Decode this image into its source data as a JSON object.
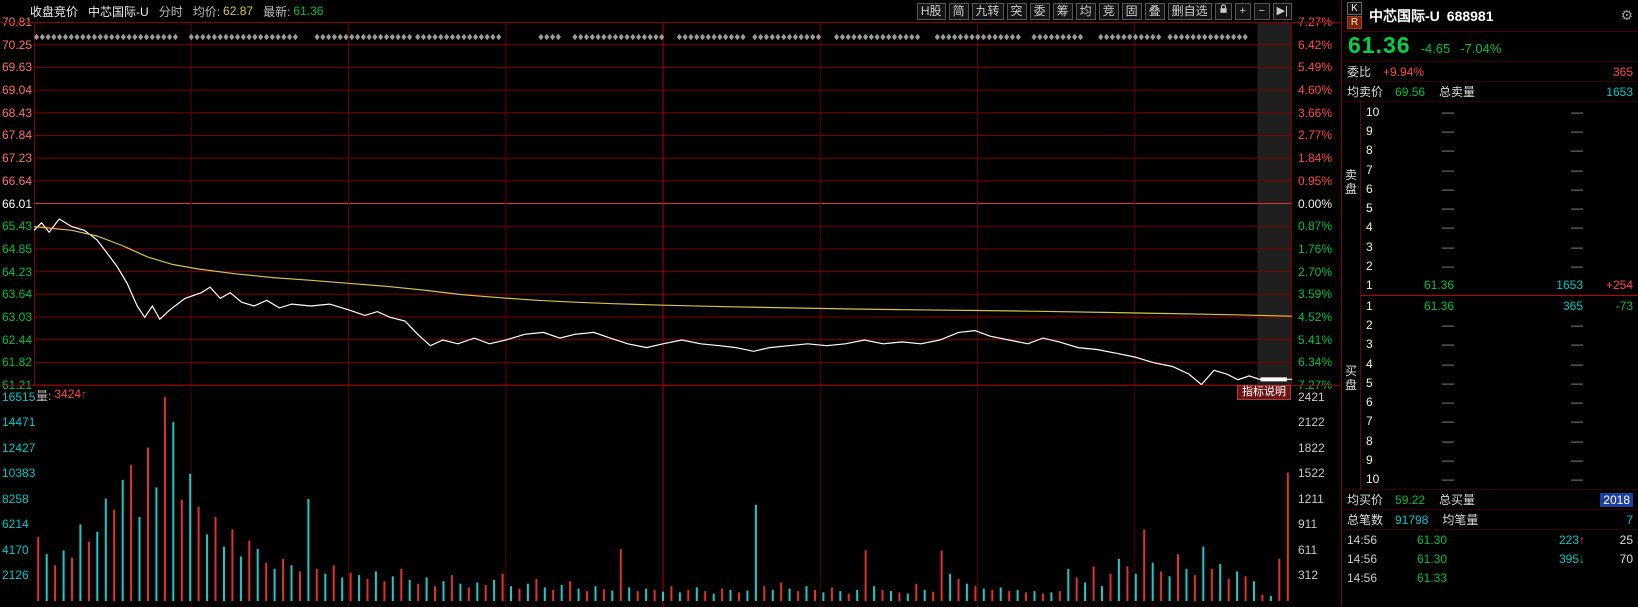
{
  "top_bar": {
    "mode_label": "收盘竞价",
    "stock_label": "中芯国际-U",
    "view_label": "分时",
    "avg_label": "均价:",
    "avg_value": "62.87",
    "last_label": "最新:",
    "last_value": "61.36",
    "buttons": [
      "H股",
      "简",
      "九转",
      "突",
      "委",
      "筹",
      "均",
      "竞",
      "固",
      "叠",
      "删自选"
    ],
    "icon_buttons": [
      "lock",
      "plus",
      "minus",
      "next"
    ]
  },
  "axes": {
    "price_left": [
      "70.81",
      "70.25",
      "69.63",
      "69.04",
      "68.43",
      "67.84",
      "67.23",
      "66.64",
      "66.01",
      "65.43",
      "64.85",
      "64.23",
      "63.64",
      "63.03",
      "62.44",
      "61.82",
      "61.21"
    ],
    "pct_right": [
      "7.27%",
      "6.42%",
      "5.49%",
      "4.60%",
      "3.66%",
      "2.77%",
      "1.84%",
      "0.95%",
      "0.00%",
      "0.87%",
      "1.76%",
      "2.70%",
      "3.59%",
      "4.52%",
      "5.41%",
      "6.34%",
      "7.27%"
    ],
    "vol_left": [
      "16515",
      "14471",
      "12427",
      "10383",
      "8258",
      "6214",
      "4170",
      "2126"
    ],
    "vol_right": [
      "2421",
      "2122",
      "1822",
      "1522",
      "1211",
      "911",
      "611",
      "312"
    ]
  },
  "volume_header": {
    "label": "量:",
    "value": "3424",
    "arrow": "↑",
    "right_button": "指标说明"
  },
  "chart_data": {
    "type": "line",
    "title": "中芯国际-U 分时",
    "prev_close": 66.01,
    "price_range": [
      61.21,
      70.81
    ],
    "x_axis": "time 09:30-15:00 (normalized 0-1, closing auction zone at right)",
    "vgrid": [
      0.125,
      0.25,
      0.375,
      0.5,
      0.625,
      0.75,
      0.875
    ],
    "auction_zone": [
      0.9725,
      1.0
    ],
    "diamond_clusters": [
      [
        0.002,
        0.115
      ],
      [
        0.125,
        0.21
      ],
      [
        0.225,
        0.3
      ],
      [
        0.305,
        0.37
      ],
      [
        0.403,
        0.418
      ],
      [
        0.43,
        0.5
      ],
      [
        0.513,
        0.565
      ],
      [
        0.573,
        0.625
      ],
      [
        0.638,
        0.705
      ],
      [
        0.718,
        0.785
      ],
      [
        0.795,
        0.835
      ],
      [
        0.848,
        0.895
      ],
      [
        0.903,
        0.965
      ]
    ],
    "series": [
      {
        "name": "price",
        "color": "#ffffff",
        "points": [
          [
            0,
            65.3
          ],
          [
            0.006,
            65.5
          ],
          [
            0.012,
            65.25
          ],
          [
            0.02,
            65.6
          ],
          [
            0.03,
            65.4
          ],
          [
            0.04,
            65.3
          ],
          [
            0.05,
            65.05
          ],
          [
            0.058,
            64.7
          ],
          [
            0.066,
            64.35
          ],
          [
            0.074,
            63.9
          ],
          [
            0.082,
            63.3
          ],
          [
            0.088,
            63.0
          ],
          [
            0.094,
            63.3
          ],
          [
            0.1,
            62.95
          ],
          [
            0.108,
            63.2
          ],
          [
            0.12,
            63.5
          ],
          [
            0.133,
            63.65
          ],
          [
            0.14,
            63.8
          ],
          [
            0.148,
            63.5
          ],
          [
            0.156,
            63.65
          ],
          [
            0.165,
            63.4
          ],
          [
            0.175,
            63.3
          ],
          [
            0.185,
            63.45
          ],
          [
            0.195,
            63.25
          ],
          [
            0.205,
            63.35
          ],
          [
            0.22,
            63.3
          ],
          [
            0.235,
            63.35
          ],
          [
            0.25,
            63.2
          ],
          [
            0.263,
            63.05
          ],
          [
            0.273,
            63.15
          ],
          [
            0.283,
            63.0
          ],
          [
            0.295,
            62.9
          ],
          [
            0.305,
            62.55
          ],
          [
            0.315,
            62.25
          ],
          [
            0.325,
            62.4
          ],
          [
            0.337,
            62.3
          ],
          [
            0.35,
            62.45
          ],
          [
            0.362,
            62.3
          ],
          [
            0.375,
            62.4
          ],
          [
            0.39,
            62.55
          ],
          [
            0.405,
            62.6
          ],
          [
            0.418,
            62.45
          ],
          [
            0.43,
            62.55
          ],
          [
            0.445,
            62.6
          ],
          [
            0.458,
            62.45
          ],
          [
            0.472,
            62.3
          ],
          [
            0.487,
            62.2
          ],
          [
            0.5,
            62.3
          ],
          [
            0.515,
            62.4
          ],
          [
            0.53,
            62.3
          ],
          [
            0.545,
            62.25
          ],
          [
            0.558,
            62.2
          ],
          [
            0.572,
            62.1
          ],
          [
            0.585,
            62.2
          ],
          [
            0.6,
            62.25
          ],
          [
            0.615,
            62.3
          ],
          [
            0.63,
            62.25
          ],
          [
            0.645,
            62.3
          ],
          [
            0.66,
            62.4
          ],
          [
            0.675,
            62.3
          ],
          [
            0.69,
            62.35
          ],
          [
            0.705,
            62.3
          ],
          [
            0.72,
            62.4
          ],
          [
            0.735,
            62.6
          ],
          [
            0.748,
            62.65
          ],
          [
            0.76,
            62.5
          ],
          [
            0.775,
            62.4
          ],
          [
            0.79,
            62.3
          ],
          [
            0.802,
            62.45
          ],
          [
            0.815,
            62.35
          ],
          [
            0.83,
            62.2
          ],
          [
            0.845,
            62.15
          ],
          [
            0.86,
            62.05
          ],
          [
            0.875,
            61.95
          ],
          [
            0.89,
            61.8
          ],
          [
            0.905,
            61.7
          ],
          [
            0.918,
            61.5
          ],
          [
            0.928,
            61.22
          ],
          [
            0.938,
            61.6
          ],
          [
            0.948,
            61.5
          ],
          [
            0.957,
            61.35
          ],
          [
            0.966,
            61.45
          ],
          [
            0.974,
            61.36
          ],
          [
            1,
            61.36
          ]
        ]
      },
      {
        "name": "avg_price",
        "color": "#d8c24a",
        "points": [
          [
            0,
            65.4
          ],
          [
            0.03,
            65.3
          ],
          [
            0.05,
            65.15
          ],
          [
            0.07,
            64.9
          ],
          [
            0.09,
            64.6
          ],
          [
            0.11,
            64.4
          ],
          [
            0.13,
            64.28
          ],
          [
            0.16,
            64.15
          ],
          [
            0.19,
            64.05
          ],
          [
            0.22,
            63.98
          ],
          [
            0.25,
            63.9
          ],
          [
            0.28,
            63.82
          ],
          [
            0.31,
            63.72
          ],
          [
            0.34,
            63.6
          ],
          [
            0.37,
            63.52
          ],
          [
            0.4,
            63.45
          ],
          [
            0.43,
            63.4
          ],
          [
            0.46,
            63.36
          ],
          [
            0.5,
            63.32
          ],
          [
            0.55,
            63.28
          ],
          [
            0.6,
            63.25
          ],
          [
            0.65,
            63.22
          ],
          [
            0.7,
            63.2
          ],
          [
            0.75,
            63.18
          ],
          [
            0.8,
            63.16
          ],
          [
            0.85,
            63.13
          ],
          [
            0.9,
            63.1
          ],
          [
            0.95,
            63.07
          ],
          [
            1,
            63.03
          ]
        ]
      }
    ],
    "volume": {
      "max": 16515,
      "note": "negative = down tick (cyan), positive = up tick (red)",
      "bars": [
        5200,
        -3800,
        2900,
        -4100,
        3500,
        -6200,
        4800,
        -5600,
        -8300,
        7400,
        -9800,
        11000,
        -6800,
        12427,
        -9200,
        16515,
        -14471,
        8200,
        -10300,
        7600,
        -5400,
        6800,
        -4400,
        5800,
        -3600,
        4900,
        -4200,
        3100,
        -2600,
        3400,
        -2900,
        2400,
        -8258,
        2600,
        -2200,
        2900,
        -1900,
        2300,
        -2100,
        1800,
        -2400,
        1600,
        -2000,
        2600,
        -1700,
        1400,
        -1900,
        1200,
        -1600,
        2100,
        -1400,
        1100,
        -1500,
        1300,
        -1700,
        2200,
        -1200,
        1000,
        -1400,
        1800,
        -1100,
        900,
        -1300,
        1600,
        -1000,
        800,
        -1200,
        950,
        -850,
        4200,
        -1100,
        800,
        -1000,
        900,
        -750,
        1200,
        -700,
        900,
        -1100,
        800,
        -600,
        1000,
        -900,
        700,
        -850,
        -7800,
        1200,
        -900,
        1500,
        -1000,
        800,
        -1200,
        900,
        -700,
        1100,
        -800,
        600,
        -900,
        4100,
        -1200,
        900,
        -800,
        700,
        -600,
        1400,
        -900,
        750,
        4100,
        -2200,
        1800,
        -1400,
        1200,
        -1000,
        900,
        -1100,
        800,
        -900,
        700,
        -800,
        600,
        -700,
        800,
        -2600,
        1900,
        -1500,
        2800,
        -1200,
        2200,
        -3400,
        2800,
        -2200,
        5800,
        -3100,
        2400,
        -2000,
        3800,
        -2600,
        2100,
        -4400,
        2600,
        -3000,
        1800,
        -2400,
        2000,
        -1600,
        500,
        -400,
        3424,
        10400
      ]
    }
  },
  "panel": {
    "k_button": "K",
    "r_button": "R",
    "title": "中芯国际-U",
    "code": "688981",
    "price": "61.36",
    "change": "-4.65",
    "change_pct": "-7.04%",
    "weibi_label": "委比",
    "weibi_value": "+9.94%",
    "weicha_value": "365",
    "avg_sell_label": "均卖价",
    "avg_sell_value": "69.56",
    "total_sell_label": "总卖量",
    "total_sell_value": "1653",
    "sell_side_label": "卖盘",
    "buy_side_label": "买盘",
    "sell_rows": [
      {
        "level": "10",
        "price": "—",
        "vol": "—",
        "extra": ""
      },
      {
        "level": "9",
        "price": "—",
        "vol": "—",
        "extra": ""
      },
      {
        "level": "8",
        "price": "—",
        "vol": "—",
        "extra": ""
      },
      {
        "level": "7",
        "price": "—",
        "vol": "—",
        "extra": ""
      },
      {
        "level": "6",
        "price": "—",
        "vol": "—",
        "extra": ""
      },
      {
        "level": "5",
        "price": "—",
        "vol": "—",
        "extra": ""
      },
      {
        "level": "4",
        "price": "—",
        "vol": "—",
        "extra": ""
      },
      {
        "level": "3",
        "price": "—",
        "vol": "—",
        "extra": ""
      },
      {
        "level": "2",
        "price": "—",
        "vol": "—",
        "extra": ""
      },
      {
        "level": "1",
        "price": "61.36",
        "vol": "1653",
        "extra": "+254"
      }
    ],
    "buy_rows": [
      {
        "level": "1",
        "price": "61.36",
        "vol": "365",
        "extra": "-73"
      },
      {
        "level": "2",
        "price": "—",
        "vol": "—",
        "extra": ""
      },
      {
        "level": "3",
        "price": "—",
        "vol": "—",
        "extra": ""
      },
      {
        "level": "4",
        "price": "—",
        "vol": "—",
        "extra": ""
      },
      {
        "level": "5",
        "price": "—",
        "vol": "—",
        "extra": ""
      },
      {
        "level": "6",
        "price": "—",
        "vol": "—",
        "extra": ""
      },
      {
        "level": "7",
        "price": "—",
        "vol": "—",
        "extra": ""
      },
      {
        "level": "8",
        "price": "—",
        "vol": "—",
        "extra": ""
      },
      {
        "level": "9",
        "price": "—",
        "vol": "—",
        "extra": ""
      },
      {
        "level": "10",
        "price": "—",
        "vol": "—",
        "extra": ""
      }
    ],
    "avg_buy_label": "均买价",
    "avg_buy_value": "59.22",
    "total_buy_label": "总买量",
    "total_buy_value": "2018",
    "total_trades_label": "总笔数",
    "total_trades_value": "91798",
    "avg_trade_label": "均笔量",
    "avg_trade_value": "7",
    "ticks": [
      {
        "time": "14:56",
        "price": "61.30",
        "vol": "223",
        "dir": "up",
        "count": "25"
      },
      {
        "time": "14:56",
        "price": "61.30",
        "vol": "395",
        "dir": "down",
        "count": "70"
      },
      {
        "time": "14:56",
        "price": "61.33",
        "vol": "",
        "dir": "",
        "count": ""
      }
    ]
  }
}
